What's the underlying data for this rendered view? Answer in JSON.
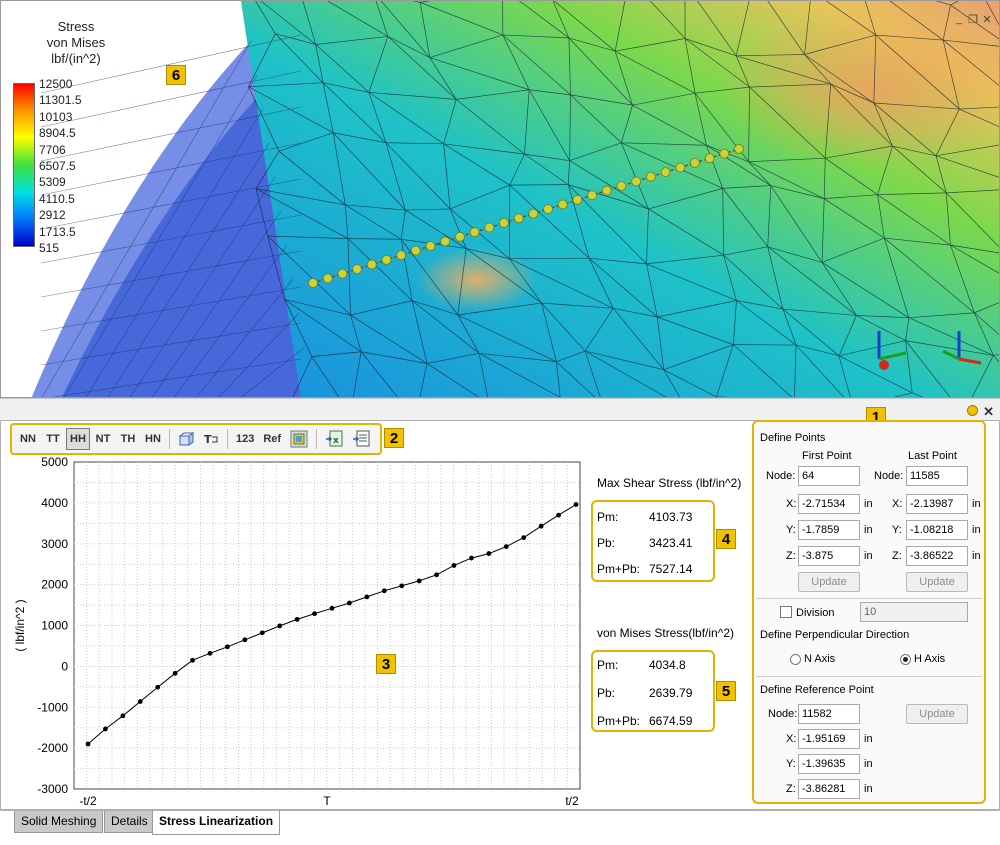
{
  "legend": {
    "title_lines": [
      "Stress",
      "von Mises",
      "lbf/(in^2)"
    ],
    "ticks": [
      "12500",
      "11301.5",
      "10103",
      "8904.5",
      "7706",
      "6507.5",
      "5309",
      "4110.5",
      "2912",
      "1713.5",
      "515"
    ]
  },
  "callouts": {
    "c1": "1",
    "c2": "2",
    "c3": "3",
    "c4": "4",
    "c5": "5",
    "c6": "6"
  },
  "toolbar": {
    "buttons": [
      "NN",
      "TT",
      "HH",
      "NT",
      "TH",
      "HN"
    ],
    "active": "HH",
    "numbers_label": "123",
    "ref_label": "Ref"
  },
  "chart_data": {
    "type": "line",
    "ylabel": "( lbf/in^2 )",
    "xlabel": "T",
    "x_tick_labels": [
      "-t/2",
      "t/2"
    ],
    "ylim": [
      -3000,
      5000
    ],
    "yticks": [
      -3000,
      -2000,
      -1000,
      0,
      1000,
      2000,
      3000,
      4000,
      5000
    ],
    "grid": true,
    "series": [
      {
        "values": [
          -1900,
          -1530,
          -1210,
          -860,
          -510,
          -170,
          150,
          320,
          480,
          650,
          820,
          990,
          1150,
          1290,
          1420,
          1550,
          1700,
          1850,
          1970,
          2090,
          2240,
          2470,
          2650,
          2760,
          2930,
          3150,
          3430,
          3700,
          3960
        ]
      }
    ]
  },
  "results": {
    "max_shear": {
      "title": "Max Shear Stress (lbf/in^2)",
      "pm_label": "Pm:",
      "pm": "4103.73",
      "pb_label": "Pb:",
      "pb": "3423.41",
      "pmpb_label": "Pm+Pb:",
      "pmpb": "7527.14"
    },
    "von_mises": {
      "title": "von Mises Stress(lbf/in^2)",
      "pm_label": "Pm:",
      "pm": "4034.8",
      "pb_label": "Pb:",
      "pb": "2639.79",
      "pmpb_label": "Pm+Pb:",
      "pmpb": "6674.59"
    }
  },
  "side": {
    "define_points": "Define Points",
    "first_point": "First Point",
    "last_point": "Last Point",
    "node_label": "Node:",
    "first": {
      "node": "64",
      "x": "-2.71534",
      "y": "-1.7859",
      "z": "-3.875"
    },
    "last": {
      "node": "11585",
      "x": "-2.13987",
      "y": "-1.08218",
      "z": "-3.86522"
    },
    "x_label": "X:",
    "y_label": "Y:",
    "z_label": "Z:",
    "unit": "in",
    "update": "Update",
    "division_label": "Division",
    "division_value": "10",
    "perp_title": "Define Perpendicular Direction",
    "n_axis": "N Axis",
    "h_axis": "H Axis",
    "ref_title": "Define Reference Point",
    "ref": {
      "node": "11582",
      "x": "-1.95169",
      "y": "-1.39635",
      "z": "-3.86281"
    }
  },
  "tabs": [
    "Solid Meshing",
    "Details",
    "Stress Linearization"
  ],
  "active_tab": "Stress Linearization",
  "colors": {
    "callout": "#f2c200",
    "frame": "#e0b400"
  }
}
